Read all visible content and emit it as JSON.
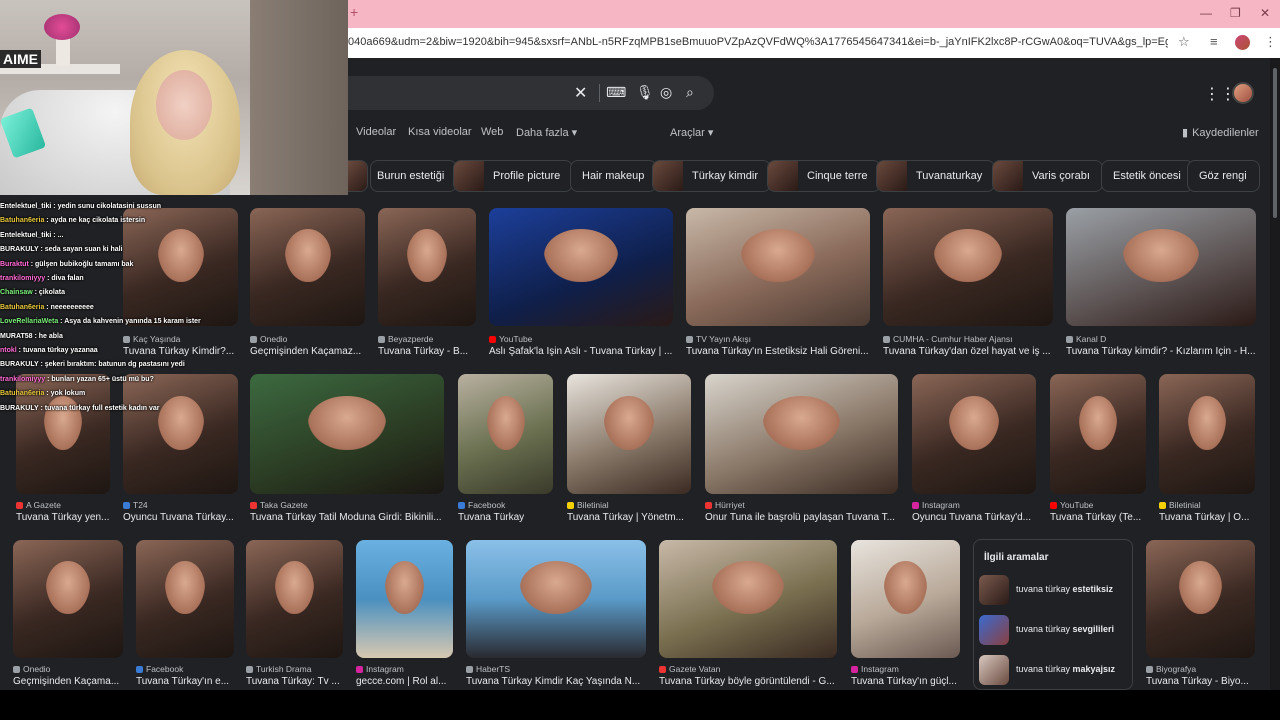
{
  "browser": {
    "newtab": "+",
    "url": "040a669&udm=2&biw=1920&bih=945&sxsrf=ANbL-n5RFzqMPB1seBmuuoPVZpAzQVFdWQ%3A1776545647341&ei=b-_jaYnIFK2lxc8P-rCGwA0&oq=TUVA&gs_lp=Egtnd3Mtd2l6LWltZyIEVFVWQSo...",
    "controls": {
      "minimize": "—",
      "restore": "❐",
      "close": "✕"
    },
    "icons": [
      "star-icon",
      "reading-list-icon",
      "profile-icon",
      "menu-icon"
    ]
  },
  "search": {
    "icons": [
      "clear-icon",
      "keyboard-icon",
      "mic-icon",
      "lens-icon",
      "search-icon"
    ]
  },
  "nav": {
    "tabs": [
      "Videolar",
      "Kısa videolar",
      "Web",
      "Daha fazla ▾"
    ],
    "tools": "Araçlar ▾",
    "saved": "Kaydedilenler"
  },
  "chips": [
    "",
    "Burun estetiği",
    "Profile picture",
    "Hair makeup",
    "Türkay kimdir",
    "Cinque terre",
    "Tuvanaturkay",
    "Varis çorabı",
    "Estetik öncesi",
    "Göz rengi"
  ],
  "results_row1": [
    {
      "source": "Kaç Yaşında",
      "title": "Tuvana Türkay Kimdir?..."
    },
    {
      "source": "Onedio",
      "title": "Geçmişinden Kaçamaz..."
    },
    {
      "source": "Beyazperde",
      "title": "Tuvana Türkay - B..."
    },
    {
      "source": "YouTube",
      "title": "Aslı Şafak'la İşin Aslı - Tuvana Türkay | ..."
    },
    {
      "source": "TV Yayın Akışı",
      "title": "Tuvana Türkay'ın Estetiksiz Hali Göreni..."
    },
    {
      "source": "CUMHA - Cumhur Haber Ajansı",
      "title": "Tuvana Türkay'dan özel hayat ve iş ..."
    },
    {
      "source": "Kanal D",
      "title": "Tuvana Türkay kimdir? - Kızlarım İçin - H..."
    }
  ],
  "results_row2": [
    {
      "source": "A Gazete",
      "title": "Tuvana Türkay yen..."
    },
    {
      "source": "T24",
      "title": "Oyuncu Tuvana Türkay..."
    },
    {
      "source": "Taka Gazete",
      "title": "Tuvana Türkay Tatil Moduna Girdi: Bikinili..."
    },
    {
      "source": "Facebook",
      "title": "Tuvana Türkay"
    },
    {
      "source": "Biletinial",
      "title": "Tuvana Türkay | Yönetm..."
    },
    {
      "source": "Hürriyet",
      "title": "Onur Tuna ile başrolü paylaşan Tuvana T..."
    },
    {
      "source": "Instagram",
      "title": "Oyuncu Tuvana Türkay'd..."
    },
    {
      "source": "YouTube",
      "title": "Tuvana Türkay (Te..."
    },
    {
      "source": "Biletinial",
      "title": "Tuvana Türkay | O..."
    }
  ],
  "results_row3": [
    {
      "source": "Onedio",
      "title": "Geçmişinden Kaçama..."
    },
    {
      "source": "Facebook",
      "title": "Tuvana Türkay'ın e..."
    },
    {
      "source": "Turkish Drama",
      "title": "Tuvana Türkay: Tv ..."
    },
    {
      "source": "Instagram",
      "title": "gecce.com | Rol al..."
    },
    {
      "source": "HaberTS",
      "title": "Tuvana Türkay Kimdir Kaç Yaşında N..."
    },
    {
      "source": "Gazete Vatan",
      "title": "Tuvana Türkay böyle görüntülendi - G..."
    },
    {
      "source": "Instagram",
      "title": "Tuvana Türkay'ın güçl..."
    },
    {
      "source": "Biyografya",
      "title": "Tuvana Türkay - Biyo..."
    }
  ],
  "related": {
    "heading": "İlgili aramalar",
    "items": [
      {
        "prefix": "tuvana türkay ",
        "bold": "estetiksiz"
      },
      {
        "prefix": "tuvana türkay ",
        "bold": "sevgilileri"
      },
      {
        "prefix": "tuvana türkay ",
        "bold": "makyajsız"
      }
    ]
  },
  "webcam": {
    "sign": "AIME"
  },
  "chat": [
    {
      "user": "Entelektuel_tiki",
      "msg": " : yedin sunu cikolatasini sussun",
      "color": "#ffffff"
    },
    {
      "user": "Batuhan6eria",
      "msg": " : ayda ne kaç cikolata istersin",
      "color": "#e6c53a"
    },
    {
      "user": "Entelektuel_tiki",
      "msg": " : ...",
      "color": "#ffffff"
    },
    {
      "user": "BURAKULY",
      "msg": " : seda sayan suan ki hali",
      "color": "#ffffff"
    },
    {
      "user": "Buraktut",
      "msg": " : gülşen bubikoğlu tamamı bak",
      "color": "#ff6ad5"
    },
    {
      "user": "trankilomiyyy",
      "msg": " : diva falan",
      "color": "#ff6ad5"
    },
    {
      "user": "Chainsaw",
      "msg": " : çikolata",
      "color": "#7af07a"
    },
    {
      "user": "Batuhan6eria",
      "msg": " : neeeeeeeeee",
      "color": "#e6c53a"
    },
    {
      "user": "LoveRellariaWeta",
      "msg": " : Asya da kahvenin yanında 15 karam ister",
      "color": "#7af07a"
    },
    {
      "user": "MURAT58",
      "msg": " : he abla",
      "color": "#ffffff"
    },
    {
      "user": "ntokl",
      "msg": " : tuvana türkay yazanaa",
      "color": "#ff6ad5"
    },
    {
      "user": "BURAKULY",
      "msg": " : şekeri bıraktım: batunun dg pastasını yedi",
      "color": "#ffffff"
    },
    {
      "user": "trankilomiyyy",
      "msg": " : bunları yazan 65+ üstü mü bu?",
      "color": "#ff6ad5"
    },
    {
      "user": "Batuhan6eria",
      "msg": " : yok lokum",
      "color": "#e6c53a"
    },
    {
      "user": "BURAKULY",
      "msg": " : tuvana türkay full estetik kadın var",
      "color": "#ffffff"
    }
  ]
}
